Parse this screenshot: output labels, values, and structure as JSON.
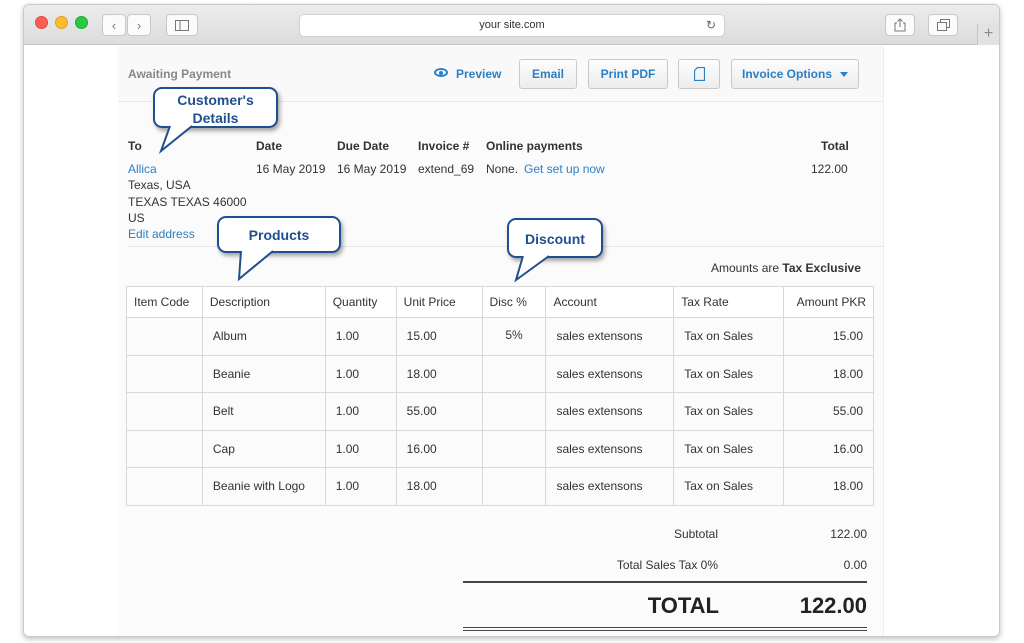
{
  "browser": {
    "address": "your site.com"
  },
  "invoice": {
    "status": "Awaiting Payment",
    "actions": {
      "preview": "Preview",
      "email": "Email",
      "print_pdf": "Print PDF",
      "options": "Invoice Options"
    },
    "header": {
      "to_label": "To",
      "date_label": "Date",
      "due_label": "Due Date",
      "invoice_label": "Invoice #",
      "online_label": "Online payments",
      "total_label": "Total",
      "customer": "Allica",
      "address1": "Texas, USA",
      "address2": "TEXAS TEXAS 46000",
      "address3": "US",
      "edit_address": "Edit address",
      "date": "16 May 2019",
      "due": "16 May 2019",
      "number": "extend_69",
      "online_none": "None.",
      "online_setup": "Get set up now",
      "total": "122.00"
    },
    "amounts_note": "Amounts are",
    "amounts_mode": "Tax Exclusive",
    "columns": [
      "Item Code",
      "Description",
      "Quantity",
      "Unit Price",
      "Disc %",
      "Account",
      "Tax Rate",
      "Amount PKR"
    ],
    "rows": [
      {
        "code": "",
        "desc": "Album",
        "qty": "1.00",
        "price": "15.00",
        "disc": "5%",
        "account": "sales extensons",
        "tax": "Tax on Sales",
        "amount": "15.00"
      },
      {
        "code": "",
        "desc": "Beanie",
        "qty": "1.00",
        "price": "18.00",
        "disc": "",
        "account": "sales extensons",
        "tax": "Tax on Sales",
        "amount": "18.00"
      },
      {
        "code": "",
        "desc": "Belt",
        "qty": "1.00",
        "price": "55.00",
        "disc": "",
        "account": "sales extensons",
        "tax": "Tax on Sales",
        "amount": "55.00"
      },
      {
        "code": "",
        "desc": "Cap",
        "qty": "1.00",
        "price": "16.00",
        "disc": "",
        "account": "sales extensons",
        "tax": "Tax on Sales",
        "amount": "16.00"
      },
      {
        "code": "",
        "desc": "Beanie with Logo",
        "qty": "1.00",
        "price": "18.00",
        "disc": "",
        "account": "sales extensons",
        "tax": "Tax on Sales",
        "amount": "18.00"
      }
    ],
    "subtotal_label": "Subtotal",
    "subtotal": "122.00",
    "tax_label": "Total Sales Tax 0%",
    "tax": "0.00",
    "total_label": "TOTAL",
    "total": "122.00"
  },
  "callouts": {
    "customer": "Customer's Details",
    "products": "Products",
    "discount": "Discount"
  },
  "colors": {
    "link": "#2a7fc7",
    "callout_border": "#1f4f8f"
  }
}
